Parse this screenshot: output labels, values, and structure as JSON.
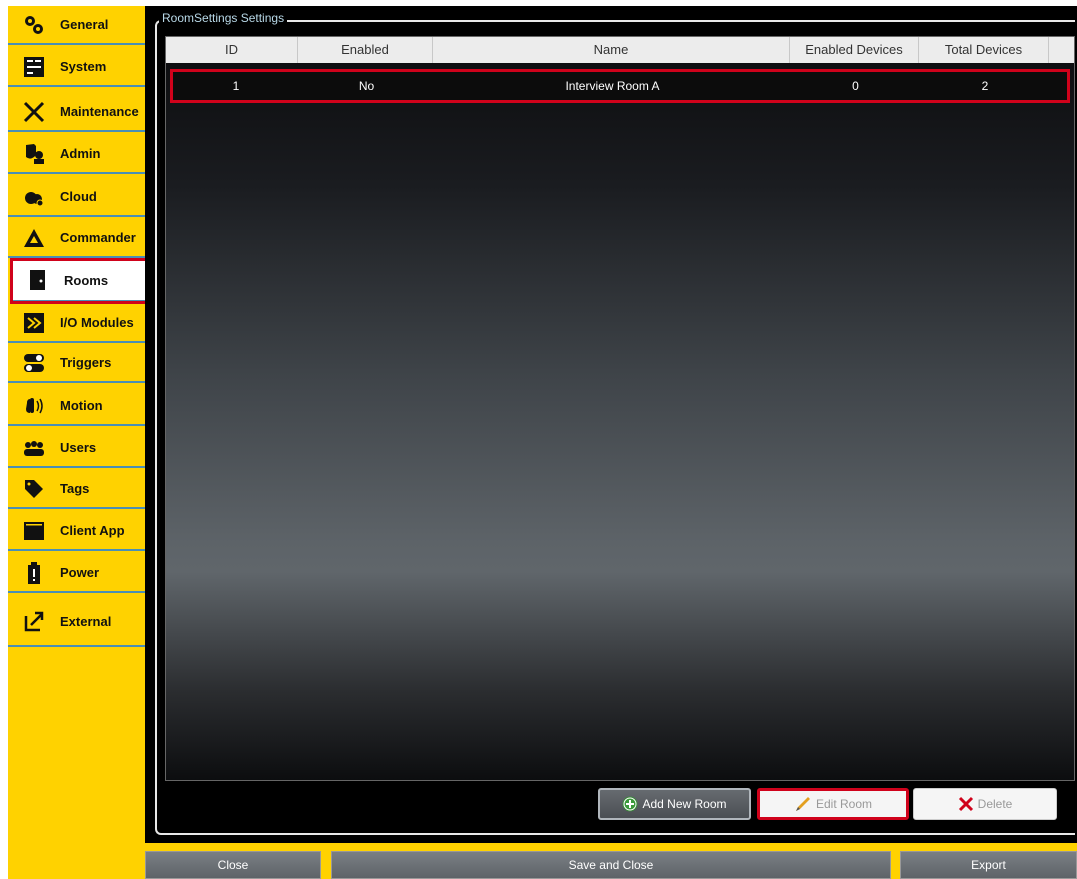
{
  "sidebar": {
    "items": [
      {
        "label": "General",
        "icon": "gears-icon"
      },
      {
        "label": "System",
        "icon": "server-icon"
      },
      {
        "label": "Maintenance",
        "icon": "tools-icon"
      },
      {
        "label": "Admin",
        "icon": "admin-shield-icon"
      },
      {
        "label": "Cloud",
        "icon": "cloud-icon"
      },
      {
        "label": "Commander",
        "icon": "commander-icon"
      },
      {
        "label": "Rooms",
        "icon": "door-icon",
        "active": true
      },
      {
        "label": "I/O Modules",
        "icon": "io-module-icon"
      },
      {
        "label": "Triggers",
        "icon": "toggle-icon"
      },
      {
        "label": "Motion",
        "icon": "hand-wave-icon"
      },
      {
        "label": "Users",
        "icon": "users-icon"
      },
      {
        "label": "Tags",
        "icon": "tag-icon"
      },
      {
        "label": "Client App",
        "icon": "window-icon"
      },
      {
        "label": "Power",
        "icon": "battery-icon"
      },
      {
        "label": "External",
        "icon": "external-link-icon"
      }
    ]
  },
  "main": {
    "group_title": "RoomSettings Settings",
    "table": {
      "columns": [
        "ID",
        "Enabled",
        "Name",
        "Enabled Devices",
        "Total Devices"
      ],
      "rows": [
        {
          "id": "1",
          "enabled": "No",
          "name": "Interview Room A",
          "enabled_devices": "0",
          "total_devices": "2"
        }
      ]
    },
    "buttons": {
      "add": "Add New Room",
      "edit": "Edit Room",
      "delete": "Delete"
    }
  },
  "footer": {
    "close": "Close",
    "save_close": "Save and Close",
    "export": "Export"
  },
  "colors": {
    "sidebar_bg": "#ffd200",
    "highlight": "#d0021b",
    "divider": "#4a8fb5"
  }
}
